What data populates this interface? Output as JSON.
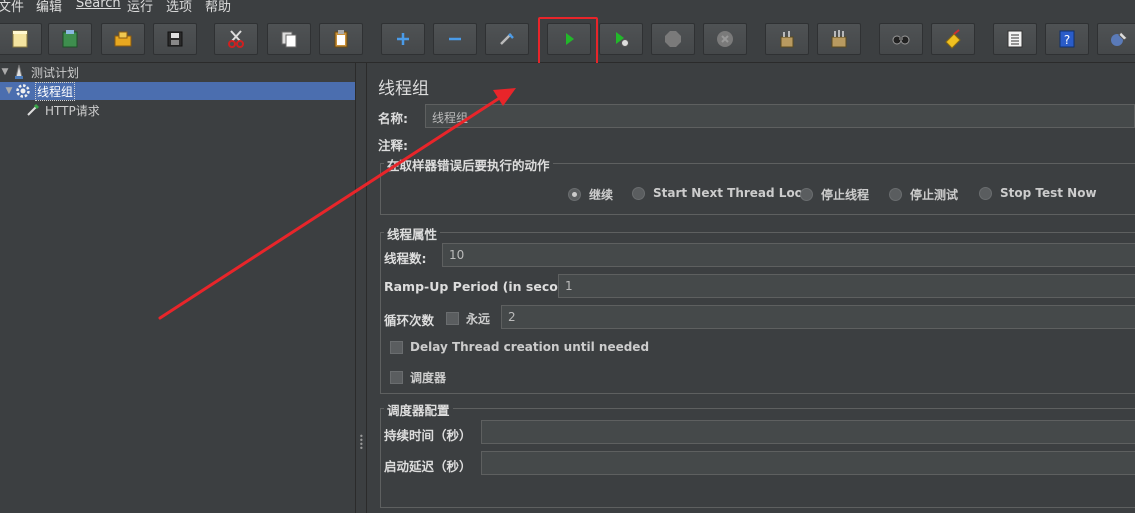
{
  "menu": {
    "items": [
      "文件",
      "编辑",
      "Search",
      "运行",
      "选项",
      "帮助"
    ]
  },
  "toolbar": {
    "buttons": [
      {
        "name": "new-icon"
      },
      {
        "name": "templates-icon"
      },
      {
        "name": "open-icon"
      },
      {
        "name": "save-icon"
      },
      {
        "name": "cut-icon"
      },
      {
        "name": "copy-icon"
      },
      {
        "name": "paste-icon"
      },
      {
        "name": "expand-icon"
      },
      {
        "name": "collapse-icon"
      },
      {
        "name": "toggle-icon"
      },
      {
        "name": "start-icon"
      },
      {
        "name": "start-no-pauses-icon"
      },
      {
        "name": "stop-icon"
      },
      {
        "name": "shutdown-icon"
      },
      {
        "name": "clear-icon"
      },
      {
        "name": "clear-all-icon"
      },
      {
        "name": "search-icon"
      },
      {
        "name": "reset-search-icon"
      },
      {
        "name": "function-helper-icon"
      },
      {
        "name": "help-icon"
      },
      {
        "name": "remote-icon"
      }
    ],
    "highlight_color": "#e8252a"
  },
  "tree": {
    "nodes": [
      {
        "label": "测试计划",
        "icon": "test-plan-icon"
      },
      {
        "label": "线程组",
        "icon": "thread-group-gear-icon",
        "selected": true
      },
      {
        "label": "HTTP请求",
        "icon": "sampler-pipette-icon"
      }
    ]
  },
  "panel": {
    "title": "线程组",
    "name_label": "名称:",
    "name_value": "线程组",
    "comment_label": "注释:",
    "on_error": {
      "title": "在取样器错误后要执行的动作",
      "options": [
        "继续",
        "Start Next Thread Loop",
        "停止线程",
        "停止测试",
        "Stop Test Now"
      ],
      "selected": "继续"
    },
    "thread_props": {
      "title": "线程属性",
      "threads_label": "线程数:",
      "threads_value": "10",
      "rampup_label": "Ramp-Up Period (in seconds):",
      "rampup_value": "1",
      "loop_label": "循环次数",
      "forever_label": "永远",
      "loop_value": "2",
      "delay_label": "Delay Thread creation until needed",
      "scheduler_label": "调度器"
    },
    "scheduler": {
      "title": "调度器配置",
      "duration_label": "持续时间（秒）",
      "duration_value": "",
      "delay_label": "启动延迟（秒）",
      "delay_value": ""
    }
  },
  "colors": {
    "background": "#3c3f41",
    "selection": "#4b6eaf",
    "annotation_red": "#e8252a"
  }
}
